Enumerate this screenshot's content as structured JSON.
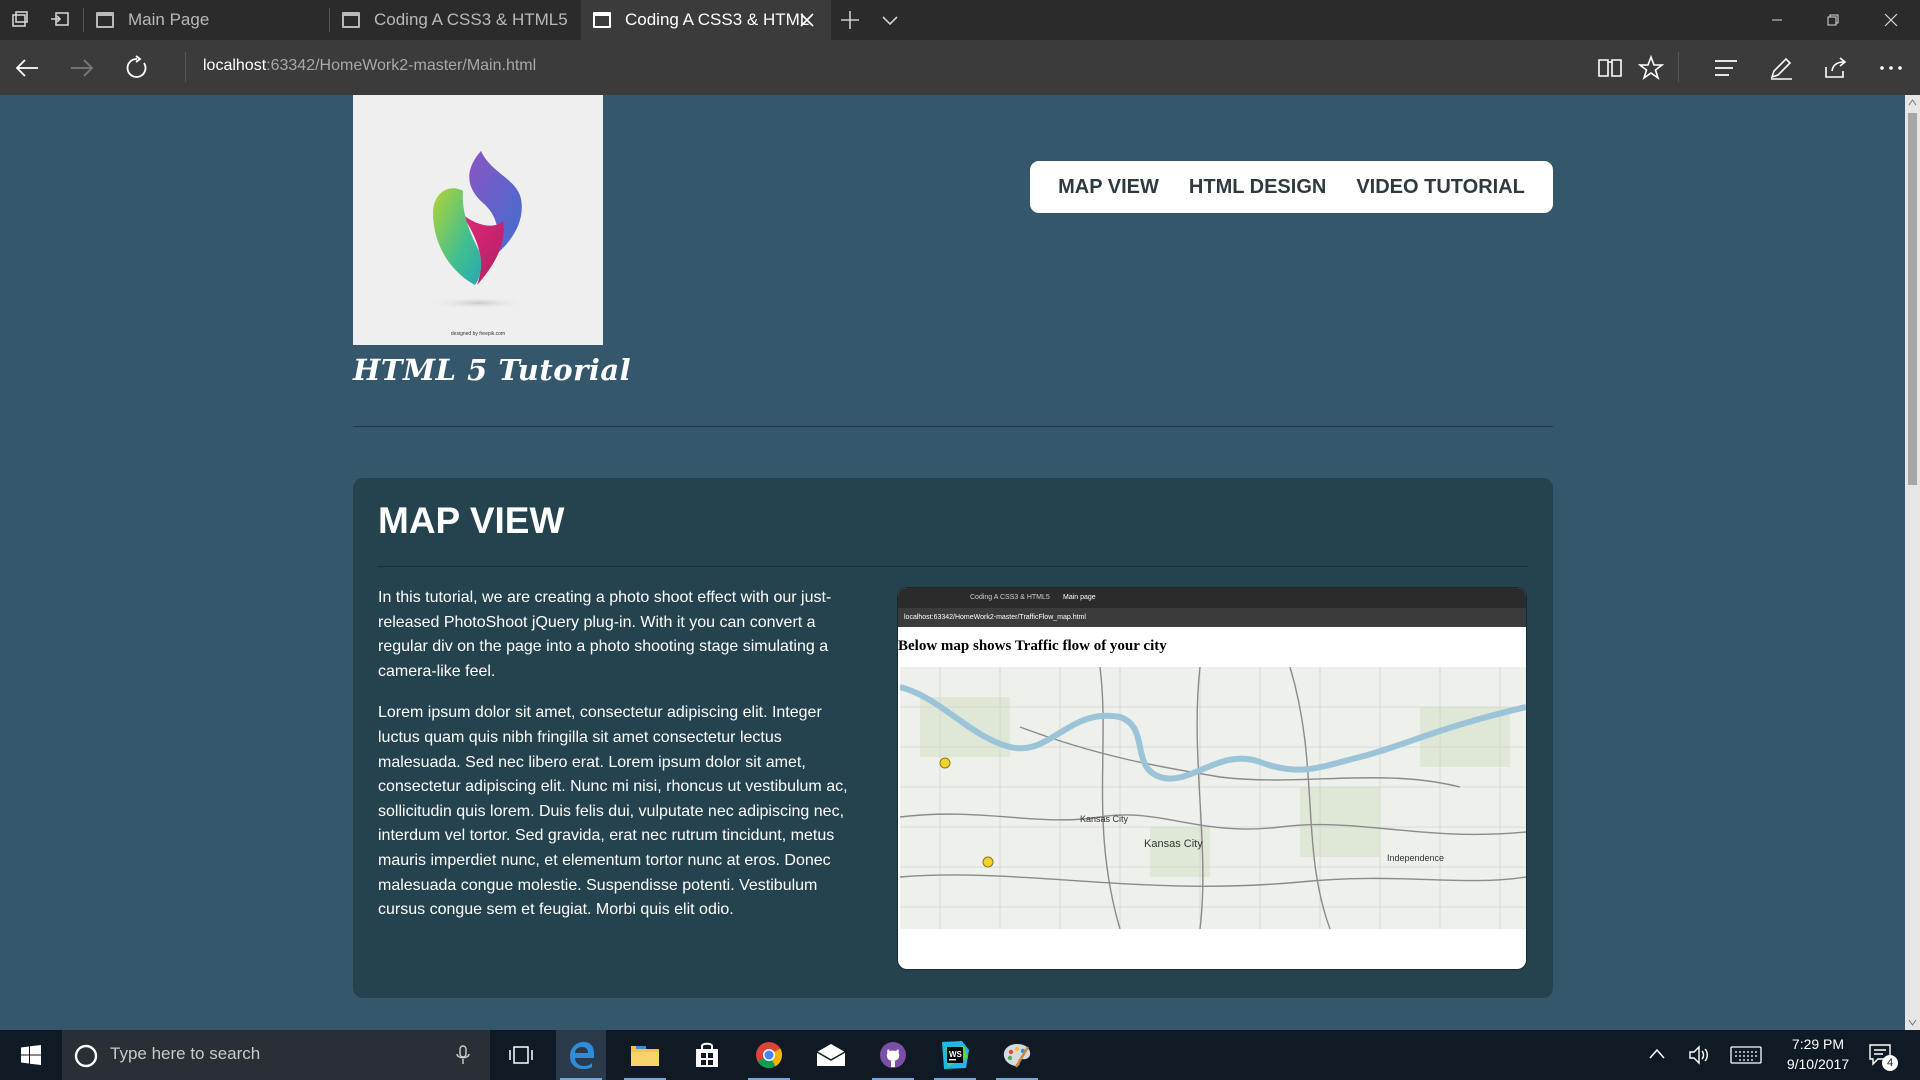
{
  "browser": {
    "tabs": [
      {
        "label": "Main Page"
      },
      {
        "label": "Coding A CSS3 & HTML5"
      },
      {
        "label": "Coding A CSS3 & HTML"
      }
    ],
    "url_host": "localhost",
    "url_rest": ":63342/HomeWork2-master/Main.html"
  },
  "page": {
    "logo_credit": "designed by freepik.com",
    "site_title": "HTML 5 Tutorial",
    "nav": [
      "MAP VIEW",
      "HTML DESIGN",
      "VIDEO TUTORIAL"
    ],
    "section_title": "MAP VIEW",
    "paragraph1": "In this tutorial, we are creating a photo shoot effect with our just-released PhotoShoot jQuery plug-in. With it you can convert a regular div on the page into a photo shooting stage simulating a camera-like feel.",
    "paragraph2": "Lorem ipsum dolor sit amet, consectetur adipiscing elit. Integer luctus quam quis nibh fringilla sit amet consectetur lectus malesuada. Sed nec libero erat. Lorem ipsum dolor sit amet, consectetur adipiscing elit. Nunc mi nisi, rhoncus ut vestibulum ac, sollicitudin quis lorem. Duis felis dui, vulputate nec adipiscing nec, interdum vel tortor. Sed gravida, erat nec rutrum tincidunt, metus mauris imperdiet nunc, et elementum tortor nunc at eros. Donec malesuada congue molestie. Suspendisse potenti. Vestibulum cursus congue sem et feugiat. Morbi quis elit odio."
  },
  "screenshot": {
    "tab1": "Coding A CSS3 & HTML5",
    "tab2": "Main page",
    "url": "localhost:63342/HomeWork2-master/TrafficFlow_map.html",
    "heading": "Below map shows Traffic flow of your city",
    "map_labels": [
      "Kansas City",
      "Kansas City",
      "Independence"
    ]
  },
  "taskbar": {
    "search_placeholder": "Type here to search",
    "time": "7:29 PM",
    "date": "9/10/2017",
    "notification_count": "4"
  },
  "colors": {
    "page_bg": "#35576b",
    "panel_bg": "#25434f",
    "titlebar": "#2b2b2b",
    "addressbar": "#3b3b3b"
  }
}
